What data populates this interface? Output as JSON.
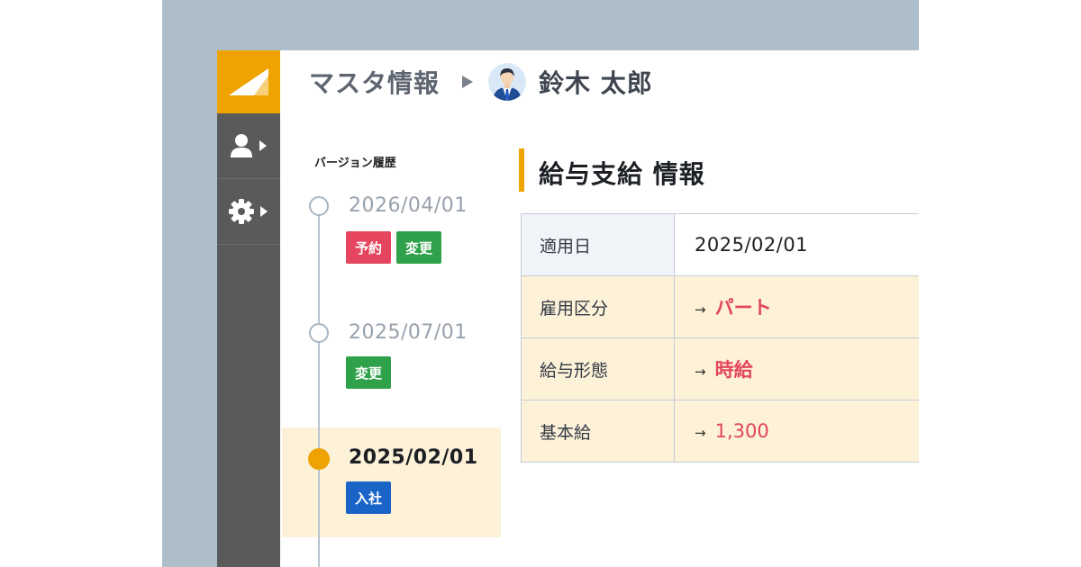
{
  "header": {
    "breadcrumb_root": "マスタ情報",
    "employee_name": "鈴木 太郎"
  },
  "sidebar": {
    "items": [
      {
        "icon": "user-icon"
      },
      {
        "icon": "gear-icon"
      }
    ]
  },
  "history": {
    "label": "バージョン履歴",
    "versions": [
      {
        "date": "2026/04/01",
        "badges": [
          "予約",
          "変更"
        ]
      },
      {
        "date": "2025/07/01",
        "badges": [
          "変更"
        ]
      },
      {
        "date": "2025/02/01",
        "badges": [
          "入社"
        ],
        "selected": true
      }
    ]
  },
  "section": {
    "title": "給与支給 情報"
  },
  "table": {
    "rows": [
      {
        "label": "適用日",
        "value": "2025/02/01"
      },
      {
        "label": "雇用区分",
        "arrow": "→",
        "value": "パート"
      },
      {
        "label": "給与形態",
        "arrow": "→",
        "value": "時給"
      },
      {
        "label": "基本給",
        "arrow": "→",
        "value": "1,300"
      }
    ]
  },
  "colors": {
    "accent": "#efa300",
    "sidebar": "#5a5a5a",
    "badge_red": "#e5455f",
    "badge_green": "#2fa14a",
    "badge_blue": "#1a64c8",
    "changed_value": "#e2455d",
    "changed_row_bg": "#fdf1d8"
  }
}
